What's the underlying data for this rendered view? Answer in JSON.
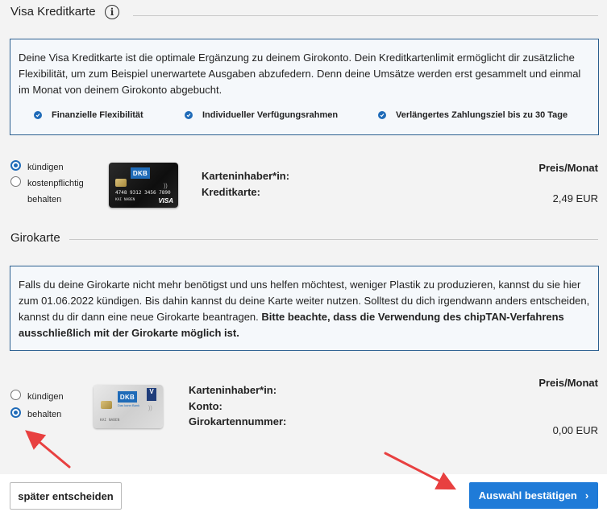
{
  "visa_section": {
    "title": "Visa Kreditkarte",
    "info_text": "Deine Visa Kreditkarte ist die optimale Ergänzung zu deinem Girokonto. Dein Kreditkartenlimit ermöglicht dir zusätzliche Flexibilität, um zum Beispiel unerwartete Ausgaben abzufedern. Denn deine Umsätze werden erst gesammelt und einmal im Monat von deinem Girokonto abgebucht.",
    "features": [
      "Finanzielle Flexibilität",
      "Individueller Verfügungsrahmen",
      "Verlängertes Zahlungsziel bis zu 30 Tage"
    ],
    "options": [
      {
        "label": "kündigen",
        "selected": true
      },
      {
        "label": "kostenpflichtig behalten",
        "selected": false
      }
    ],
    "fields": [
      "Karteninhaber*in:",
      "Kreditkarte:"
    ],
    "price_heading": "Preis/Monat",
    "price": "2,49 EUR",
    "card": {
      "brand_logo": "DKB",
      "number": "4748 9312 3456 7890",
      "holder": "KAI NABEN",
      "network": "VISA"
    }
  },
  "giro_section": {
    "title": "Girokarte",
    "info_text_regular": "Falls du deine Girokarte nicht mehr benötigst und uns helfen möchtest, weniger Plastik zu produzieren, kannst du sie hier zum 01.06.2022 kündigen. Bis dahin kannst du deine Karte weiter nutzen. Solltest du dich irgendwann anders entscheiden, kannst du dir dann eine neue Girokarte beantragen. ",
    "info_text_bold": "Bitte beachte, dass die Verwendung des chipTAN-Verfahrens ausschließlich mit der Girokarte möglich ist.",
    "options": [
      {
        "label": "kündigen",
        "selected": false
      },
      {
        "label": "behalten",
        "selected": true
      }
    ],
    "fields": [
      "Karteninhaber*in:",
      "Konto:",
      "Girokartennummer:"
    ],
    "price_heading": "Preis/Monat",
    "price": "0,00 EUR",
    "card": {
      "brand_logo": "DKB",
      "tagline": "Das kann Bank",
      "holder": "KAI NABEN",
      "badge": "V"
    }
  },
  "footer": {
    "later_label": "später entscheiden",
    "confirm_label": "Auswahl bestätigen",
    "confirm_chevron": "›"
  },
  "colors": {
    "accent": "#1f7bd8",
    "info_border": "#2b5f8f",
    "annotation_arrow": "#e84040"
  }
}
